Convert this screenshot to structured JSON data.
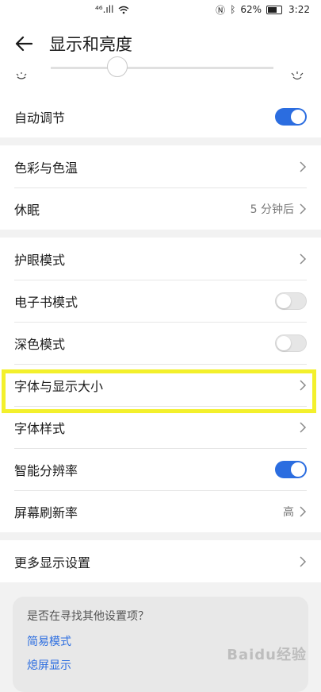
{
  "status_bar": {
    "signal_text": "⁴⁶.ıll",
    "battery_percent": "62%",
    "time": "3:22"
  },
  "header": {
    "title": "显示和亮度"
  },
  "brightness": {
    "level": 0.3
  },
  "group1": {
    "auto_adjust_label": "自动调节",
    "auto_adjust_on": true
  },
  "group2": {
    "color_temp_label": "色彩与色温",
    "sleep_label": "休眠",
    "sleep_value": "5 分钟后"
  },
  "group3": {
    "eye_comfort_label": "护眼模式",
    "ebook_label": "电子书模式",
    "dark_label": "深色模式",
    "font_size_label": "字体与显示大小",
    "font_style_label": "字体样式",
    "smart_res_label": "智能分辨率",
    "refresh_label": "屏幕刷新率",
    "refresh_value": "高"
  },
  "group4": {
    "more_label": "更多显示设置"
  },
  "suggest": {
    "question": "是否在寻找其他设置项？",
    "link1": "简易模式",
    "link2": "熄屏显示"
  },
  "watermark": "Baidu经验",
  "colors": {
    "accent": "#2b6de0",
    "highlight": "#f3f02c"
  }
}
